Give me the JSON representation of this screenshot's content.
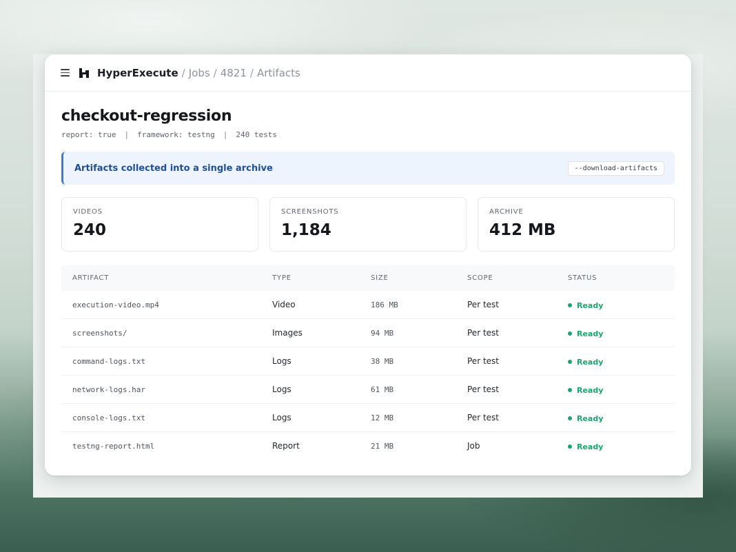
{
  "breadcrumb": {
    "app": "HyperExecute",
    "items": [
      "Jobs",
      "4821",
      "Artifacts"
    ]
  },
  "page": {
    "title": "checkout-regression",
    "meta": [
      "report: true",
      "framework: testng",
      "240 tests"
    ]
  },
  "banner": {
    "text": "Artifacts collected into a single archive",
    "flag": "--download-artifacts"
  },
  "stats": [
    {
      "label": "VIDEOS",
      "value": "240"
    },
    {
      "label": "SCREENSHOTS",
      "value": "1,184"
    },
    {
      "label": "ARCHIVE",
      "value": "412 MB"
    }
  ],
  "table": {
    "columns": [
      "ARTIFACT",
      "TYPE",
      "SIZE",
      "SCOPE",
      "STATUS"
    ],
    "rows": [
      {
        "artifact": "execution-video.mp4",
        "type": "Video",
        "size": "186 MB",
        "scope": "Per test",
        "status": "Ready"
      },
      {
        "artifact": "screenshots/",
        "type": "Images",
        "size": "94 MB",
        "scope": "Per test",
        "status": "Ready"
      },
      {
        "artifact": "command-logs.txt",
        "type": "Logs",
        "size": "38 MB",
        "scope": "Per test",
        "status": "Ready"
      },
      {
        "artifact": "network-logs.har",
        "type": "Logs",
        "size": "61 MB",
        "scope": "Per test",
        "status": "Ready"
      },
      {
        "artifact": "console-logs.txt",
        "type": "Logs",
        "size": "12 MB",
        "scope": "Per test",
        "status": "Ready"
      },
      {
        "artifact": "testng-report.html",
        "type": "Report",
        "size": "21 MB",
        "scope": "Job",
        "status": "Ready"
      }
    ]
  },
  "colors": {
    "accent": "#3b7bd8",
    "status_ready": "#1aa56d",
    "banner_bg": "#eef4fd"
  },
  "icons": {
    "menu": "hamburger-menu-icon",
    "logo": "hyperexecute-logo-icon",
    "status": "status-dot-icon"
  }
}
